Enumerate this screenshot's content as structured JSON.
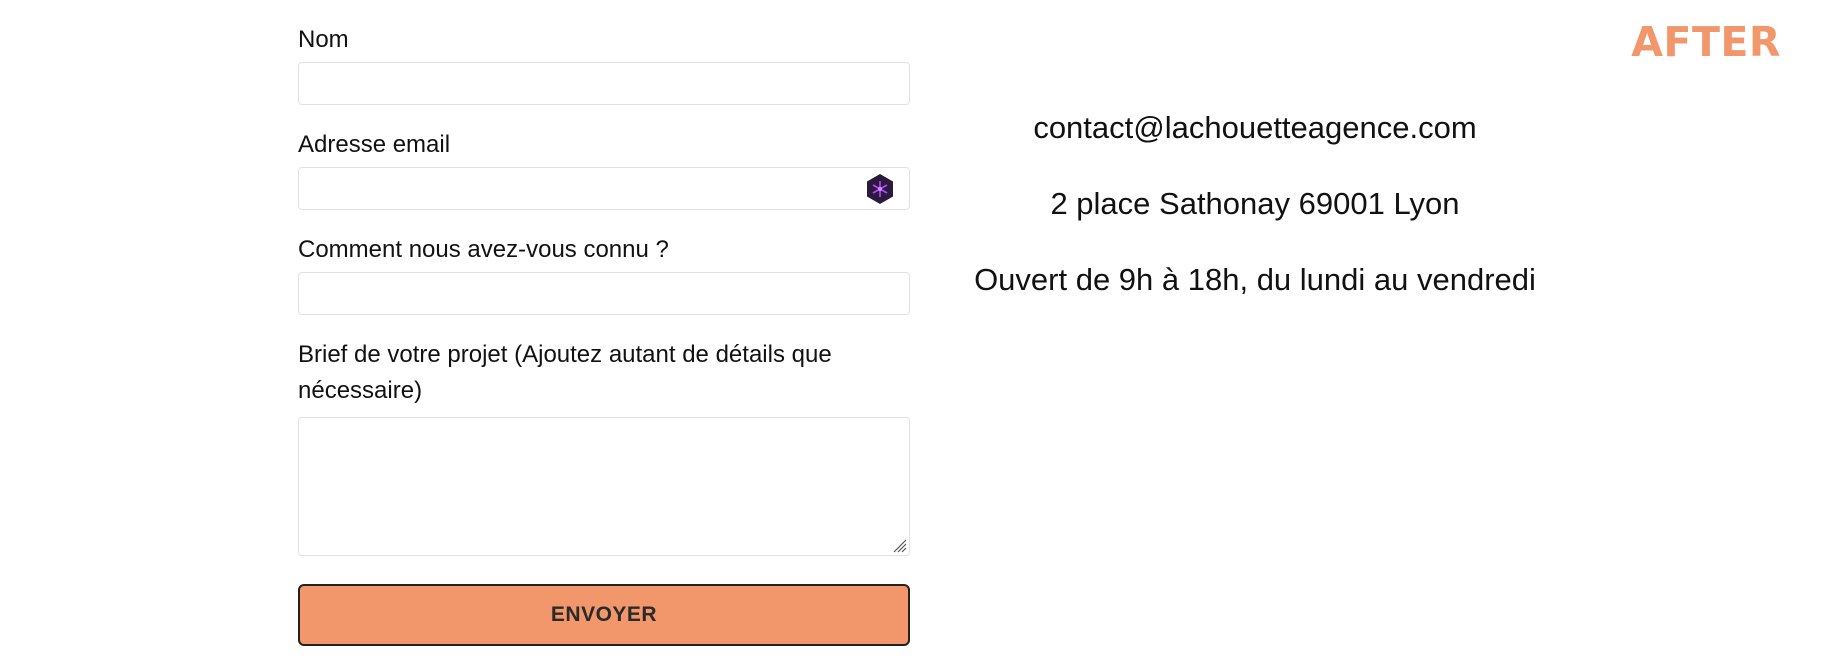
{
  "tag": "AFTER",
  "form": {
    "name_label": "Nom",
    "name_value": "",
    "email_label": "Adresse email",
    "email_value": "",
    "source_label": "Comment nous avez-vous connu ?",
    "source_value": "",
    "brief_label_line1": "Brief de votre projet (Ajoutez autant de détails que",
    "brief_label_line2": "nécessaire)",
    "brief_value": "",
    "submit_label": "ENVOYER",
    "extension_icon": "hexagon-sparkle-icon"
  },
  "contact": {
    "email": "contact@lachouetteagence.com",
    "address": "2 place Sathonay 69001 Lyon",
    "hours": "Ouvert de 9h à 18h, du lundi au vendredi"
  },
  "colors": {
    "accent": "#f2976b",
    "button_border": "#222222",
    "input_border": "#e1e1e1",
    "icon_bg": "#2b1a3d",
    "icon_glyph": "#b04bff"
  }
}
